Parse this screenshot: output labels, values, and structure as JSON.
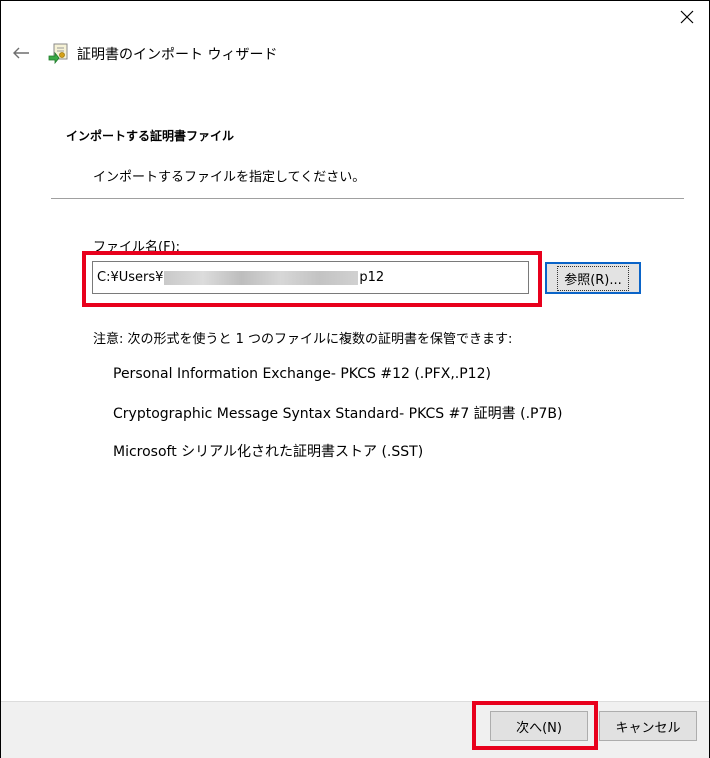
{
  "window": {
    "title": "証明書のインポート ウィザード",
    "close_glyph": "✕",
    "back_glyph": "←"
  },
  "page": {
    "heading": "インポートする証明書ファイル",
    "subheading": "インポートするファイルを指定してください。"
  },
  "file": {
    "label": "ファイル名(F):",
    "value_prefix": "C:¥Users¥",
    "value_suffix": "p12",
    "browse_label": "参照(R)..."
  },
  "note": {
    "text": "注意: 次の形式を使うと 1 つのファイルに複数の証明書を保管できます:",
    "formats": [
      "Personal Information Exchange- PKCS #12 (.PFX,.P12)",
      "Cryptographic Message Syntax Standard- PKCS #7 証明書 (.P7B)",
      "Microsoft シリアル化された証明書ストア (.SST)"
    ]
  },
  "footer": {
    "next_label": "次へ(N)",
    "cancel_label": "キャンセル"
  },
  "colors": {
    "highlight": "#e8001c",
    "focus_border": "#0a64c8"
  },
  "icons": {
    "wizard": "certificate-wizard-icon",
    "back": "back-arrow-icon",
    "close": "close-icon"
  }
}
